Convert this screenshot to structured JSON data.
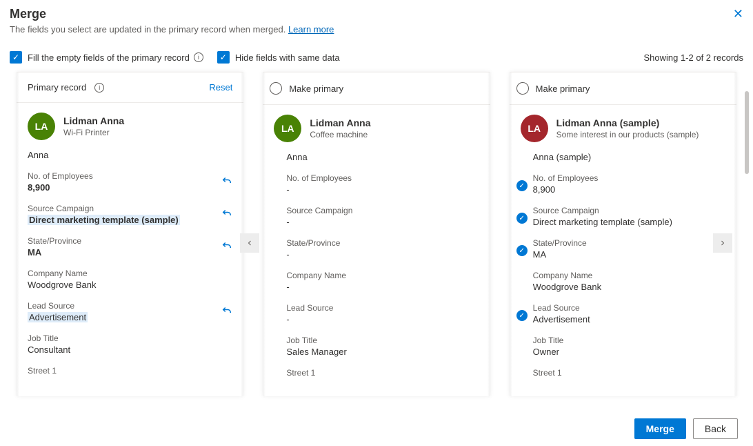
{
  "header": {
    "title": "Merge",
    "subtitle": "The fields you select are updated in the primary record when merged. ",
    "learn_more": "Learn more"
  },
  "options": {
    "fill_empty": "Fill the empty fields of the primary record",
    "hide_same": "Hide fields with same data",
    "showing": "Showing 1-2 of 2 records"
  },
  "primary_card": {
    "label": "Primary record",
    "reset": "Reset",
    "initials": "LA",
    "name": "Lidman Anna",
    "sub": "Wi-Fi Printer",
    "display_name": "Anna"
  },
  "card2": {
    "make_primary": "Make primary",
    "initials": "LA",
    "name": "Lidman Anna",
    "sub": "Coffee machine",
    "display_name": "Anna"
  },
  "card3": {
    "make_primary": "Make primary",
    "initials": "LA",
    "name": "Lidman Anna (sample)",
    "sub": "Some interest in our products (sample)",
    "display_name": "Anna (sample)"
  },
  "labels": {
    "no_employees": "No. of Employees",
    "source_campaign": "Source Campaign",
    "state": "State/Province",
    "company": "Company Name",
    "lead_source": "Lead Source",
    "job_title": "Job Title",
    "street1": "Street 1"
  },
  "primary_vals": {
    "no_employees": "8,900",
    "source_campaign": "Direct marketing template (sample)",
    "state": "MA",
    "company": "Woodgrove Bank",
    "lead_source": "Advertisement",
    "job_title": "Consultant"
  },
  "card2_vals": {
    "no_employees": "-",
    "source_campaign": "-",
    "state": "-",
    "company": "-",
    "lead_source": "-",
    "job_title": "Sales Manager"
  },
  "card3_vals": {
    "no_employees": "8,900",
    "source_campaign": "Direct marketing template (sample)",
    "state": "MA",
    "company": "Woodgrove Bank",
    "lead_source": "Advertisement",
    "job_title": "Owner"
  },
  "footer": {
    "merge": "Merge",
    "back": "Back"
  }
}
